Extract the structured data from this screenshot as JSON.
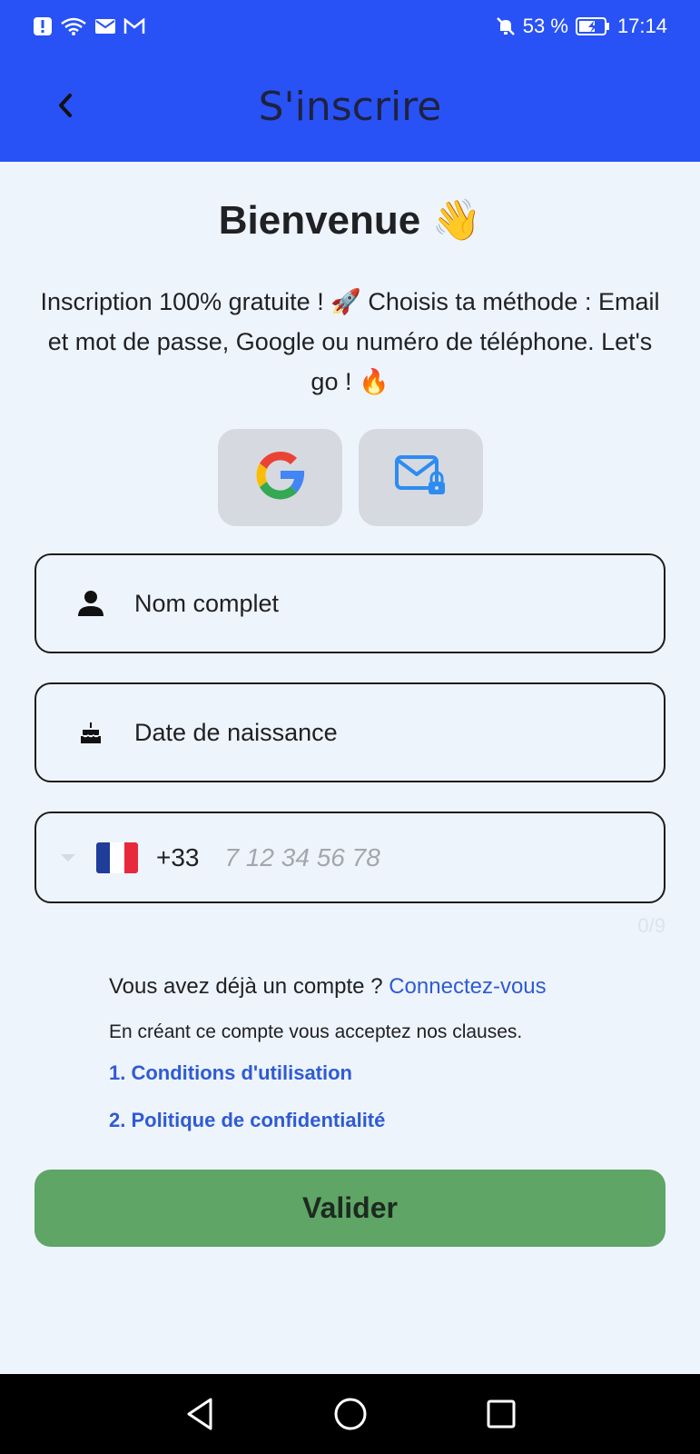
{
  "status_bar": {
    "battery": "53 %",
    "time": "17:14",
    "icons": [
      "alert-icon",
      "wifi-icon",
      "mail-icon",
      "gmail-icon",
      "bell-off-icon",
      "battery-charging-icon"
    ]
  },
  "header": {
    "title": "S'inscrire",
    "back_icon": "chevron-left-icon"
  },
  "welcome": {
    "title": "Bienvenue 👋",
    "description": "Inscription 100% gratuite ! 🚀 Choisis ta méthode : Email et mot de passe, Google ou numéro de téléphone. Let's go ! 🔥"
  },
  "social": {
    "google_icon": "google-icon",
    "email_icon": "email-lock-icon"
  },
  "form": {
    "full_name_label": "Nom complet",
    "birthdate_label": "Date de naissance",
    "phone": {
      "country_flag": "france-flag-icon",
      "dial_code": "+33",
      "placeholder": "7 12 34 56 78",
      "counter": "0/9"
    }
  },
  "account": {
    "have_account_text": "Vous avez déjà un compte ?",
    "login_link": "Connectez-vous",
    "clauses_text": "En créant ce compte vous acceptez nos clauses.",
    "terms_link": "1. Conditions d'utilisation",
    "privacy_link": "2. Politique de confidentialité"
  },
  "actions": {
    "submit_label": "Valider"
  },
  "colors": {
    "primary": "#2852f5",
    "background": "#eef4fc",
    "submit": "#5ea566",
    "link": "#2f5bd3"
  }
}
